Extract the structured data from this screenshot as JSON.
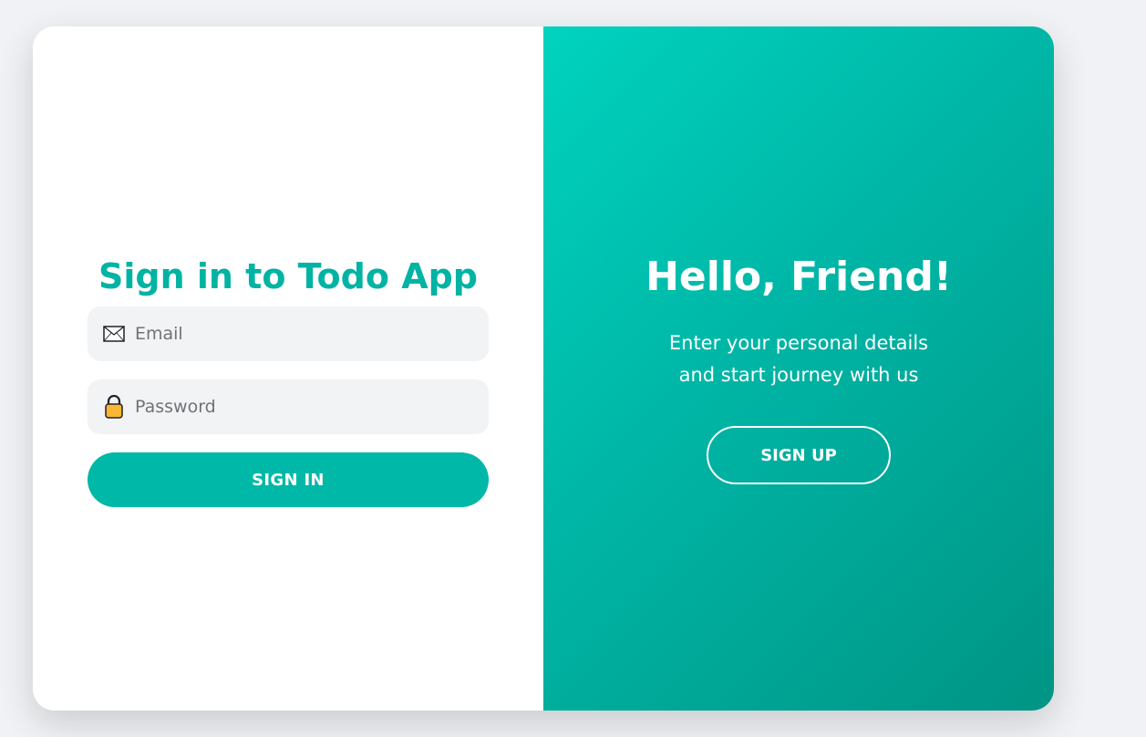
{
  "signin": {
    "title": "Sign in to Todo App",
    "email_placeholder": "Email",
    "password_placeholder": "Password",
    "submit_label": "SIGN IN",
    "email_icon": "envelope-icon",
    "password_icon": "lock-icon"
  },
  "welcome": {
    "title": "Hello, Friend!",
    "line1": "Enter your personal details",
    "line2": "and start journey with us",
    "signup_label": "SIGN UP"
  },
  "colors": {
    "accent": "#00b3a3",
    "panel_gradient_start": "#00d3be",
    "panel_gradient_end": "#009484",
    "field_background": "#f2f3f5",
    "lock_fill": "#f7b733"
  }
}
